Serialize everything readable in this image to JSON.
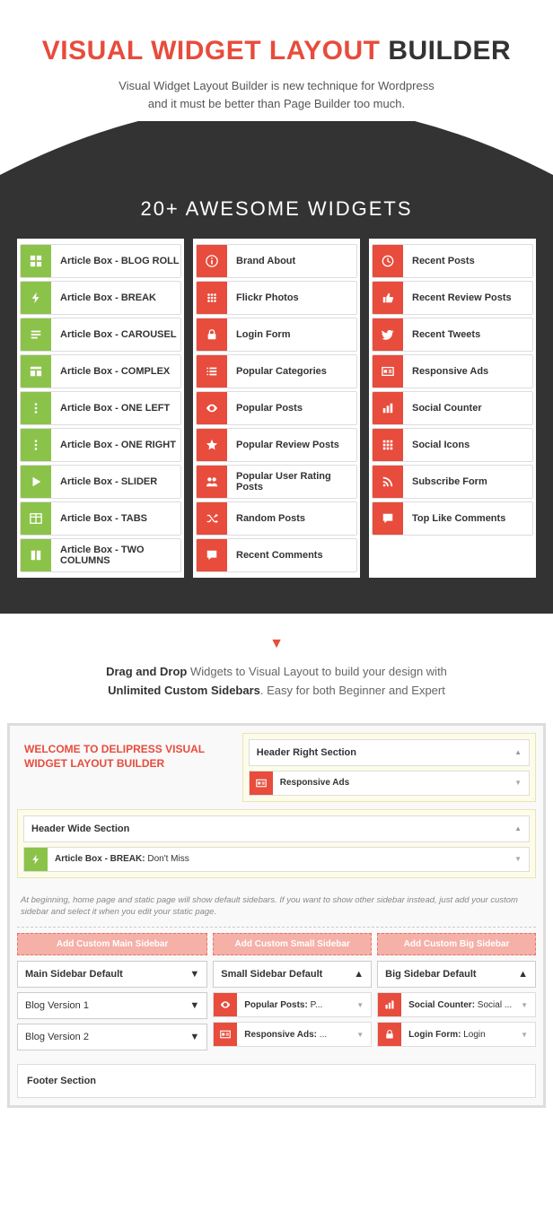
{
  "hero": {
    "title_red": "VISUAL WIDGET LAYOUT",
    "title_dark": "BUILDER",
    "sub1": "Visual Widget Layout Builder is new technique for Wordpress",
    "sub2": "and it must be better than Page Builder too much."
  },
  "widgets_title": "20+ AWESOME WIDGETS",
  "widgets": {
    "col1": [
      {
        "label": "Article Box - BLOG ROLL",
        "icon": "grid"
      },
      {
        "label": "Article Box - BREAK",
        "icon": "bolt"
      },
      {
        "label": "Article Box - CAROUSEL",
        "icon": "align"
      },
      {
        "label": "Article Box - COMPLEX",
        "icon": "layout"
      },
      {
        "label": "Article Box - ONE LEFT",
        "icon": "dots"
      },
      {
        "label": "Article Box - ONE RIGHT",
        "icon": "dots"
      },
      {
        "label": "Article Box - SLIDER",
        "icon": "play"
      },
      {
        "label": "Article Box - TABS",
        "icon": "table"
      },
      {
        "label": "Article Box - TWO COLUMNS",
        "icon": "cols"
      }
    ],
    "col2": [
      {
        "label": "Brand About",
        "icon": "info"
      },
      {
        "label": "Flickr Photos",
        "icon": "dots-grid"
      },
      {
        "label": "Login Form",
        "icon": "lock"
      },
      {
        "label": "Popular Categories",
        "icon": "list"
      },
      {
        "label": "Popular Posts",
        "icon": "eye"
      },
      {
        "label": "Popular Review Posts",
        "icon": "star"
      },
      {
        "label": "Popular User Rating Posts",
        "icon": "group"
      },
      {
        "label": "Random Posts",
        "icon": "shuffle"
      },
      {
        "label": "Recent Comments",
        "icon": "comment"
      }
    ],
    "col3": [
      {
        "label": "Recent Posts",
        "icon": "clock"
      },
      {
        "label": "Recent Review Posts",
        "icon": "thumb"
      },
      {
        "label": "Recent Tweets",
        "icon": "twitter"
      },
      {
        "label": "Responsive Ads",
        "icon": "ad"
      },
      {
        "label": "Social Counter",
        "icon": "bars"
      },
      {
        "label": "Social Icons",
        "icon": "grid3"
      },
      {
        "label": "Subscribe Form",
        "icon": "rss"
      },
      {
        "label": "Top Like Comments",
        "icon": "comment"
      }
    ]
  },
  "dd": {
    "b1": "Drag and Drop",
    "t1": " Widgets to Visual Layout to build your design with ",
    "b2": "Unlimited Custom Sidebars",
    "t2": ". Easy for both Beginner and Expert"
  },
  "builder": {
    "welcome": "WELCOME TO DELIPRESS VISUAL WIDGET LAYOUT BUILDER",
    "header_right": "Header Right Section",
    "header_right_item": "Responsive Ads",
    "header_wide": "Header Wide Section",
    "header_wide_item_b": "Article Box - BREAK:",
    "header_wide_item_t": " Don't Miss",
    "note": "At beginning, home page and static page will show default sidebars. If you want to show other sidebar instead, just add your custom sidebar and select it when you edit your static page.",
    "add_main": "Add Custom Main Sidebar",
    "add_small": "Add Custom Small Sidebar",
    "add_big": "Add Custom Big Sidebar",
    "main_default": "Main Sidebar Default",
    "blog1": "Blog Version 1",
    "blog2": "Blog Version 2",
    "small_default": "Small Sidebar Default",
    "small_i1_b": "Popular Posts:",
    "small_i1_t": " P...",
    "small_i2_b": "Responsive Ads:",
    "small_i2_t": " ...",
    "big_default": "Big Sidebar Default",
    "big_i1_b": "Social Counter:",
    "big_i1_t": " Social ...",
    "big_i2_b": "Login Form:",
    "big_i2_t": " Login",
    "footer": "Footer Section"
  }
}
